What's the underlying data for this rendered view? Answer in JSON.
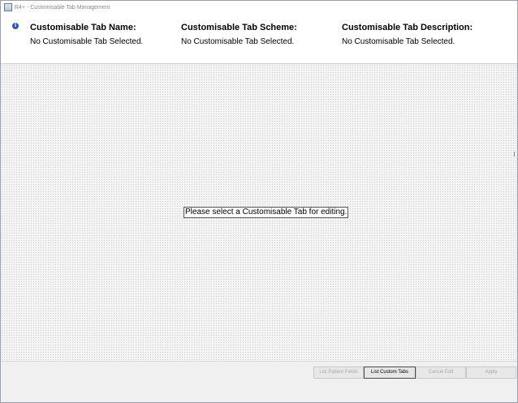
{
  "window": {
    "title": "R4+ - Customisable Tab Management"
  },
  "header": {
    "name_label": "Customisable Tab Name:",
    "name_value": "No Customisable Tab Selected.",
    "scheme_label": "Customisable Tab Scheme:",
    "scheme_value": "No Customisable Tab Selected.",
    "description_label": "Customisable Tab Description:",
    "description_value": "No Customisable Tab Selected.",
    "icon": "info-icon"
  },
  "canvas": {
    "message": "Please select a Customisable Tab for editing."
  },
  "footer": {
    "list_patient_fields": "List Patient Fields",
    "list_custom_tabs": "List Custom Tabs",
    "cancel_edit": "Cancel Edit",
    "apply": "Apply"
  }
}
